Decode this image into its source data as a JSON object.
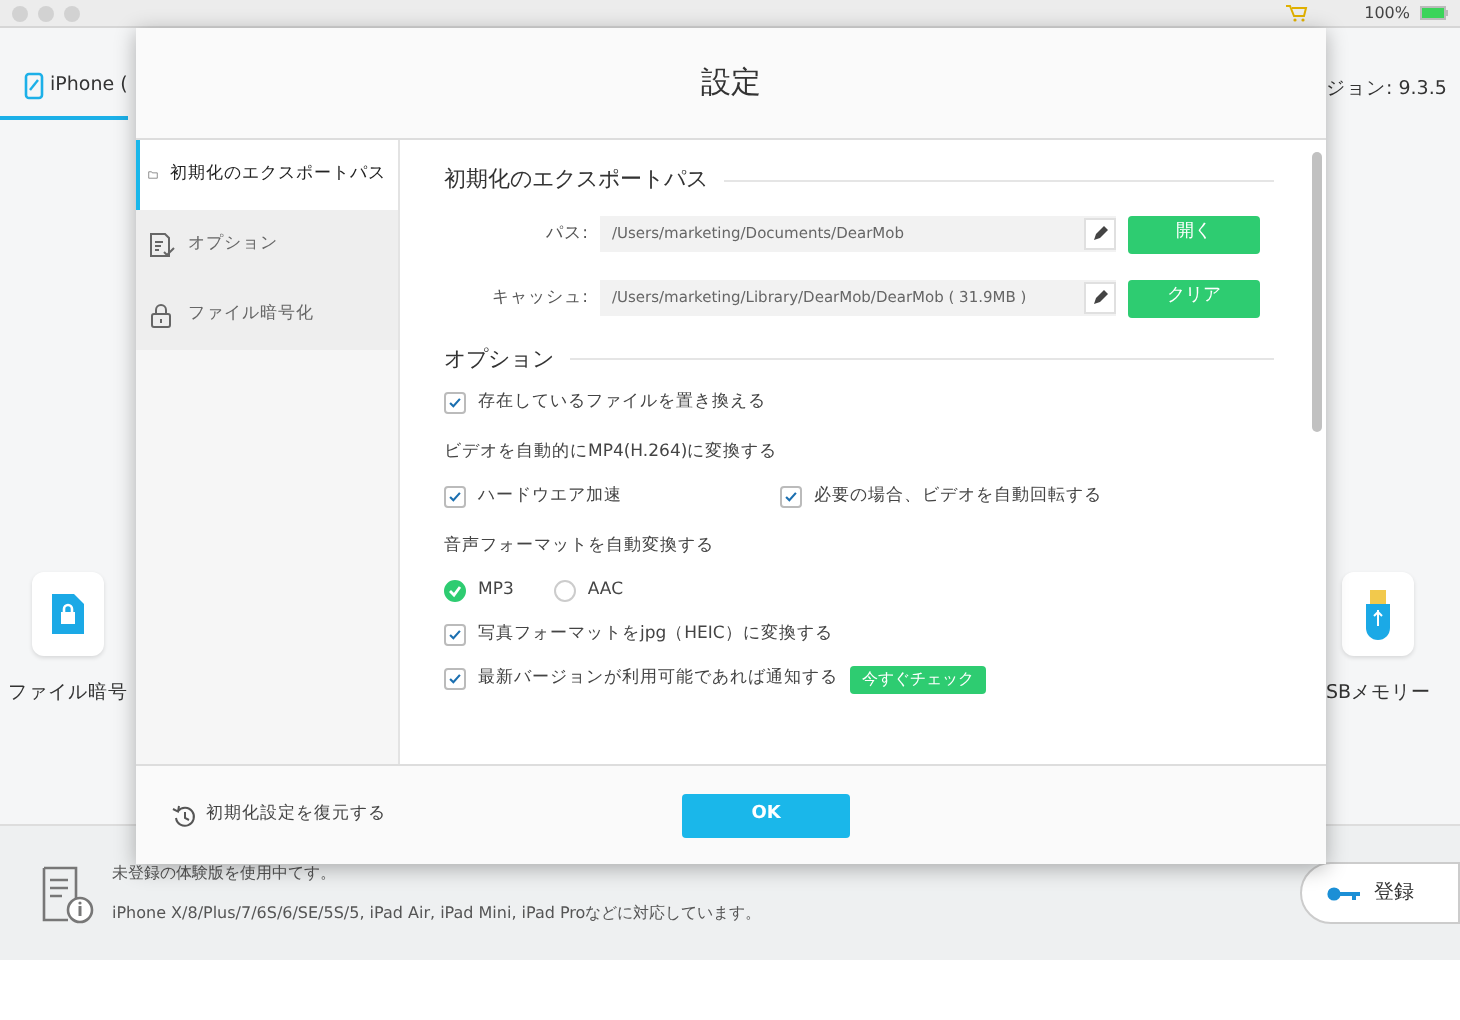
{
  "status_bar": {
    "battery": "100%"
  },
  "app": {
    "device_tab": {
      "label": "iPhone (",
      "selected": true
    },
    "version": "ジョン: 9.3.5",
    "tools": [
      {
        "label": "ファイル暗号",
        "kind": "lock"
      },
      {
        "label": "SBメモリー",
        "kind": "usb"
      }
    ]
  },
  "footer": {
    "lines": [
      "未登録の体験版を使用中てす。",
      "iPhone X/8/Plus/7/6S/6/SE/5S/5, iPad Air, iPad Mini, iPad Proなどに対応しています。"
    ],
    "register_button": "登録"
  },
  "dialog": {
    "title": "設定",
    "sidebar": [
      {
        "label": "初期化のエクスポートパス",
        "selected": true
      },
      {
        "label": "オプション",
        "selected": false
      },
      {
        "label": "ファイル暗号化",
        "selected": false
      }
    ],
    "export_heading": "初期化のエクスポートパス",
    "paths": [
      {
        "label": "パス:",
        "value": "/Users/marketing/Documents/DearMob",
        "button": "開く"
      },
      {
        "label": "キャッシュ:",
        "value": "/Users/marketing/Library/DearMob/DearMob ( 31.9MB )",
        "button": "クリア"
      }
    ],
    "options_heading": "オプション",
    "options": [
      {
        "kind": "checkbox",
        "label": "存在しているファイルを置き換える",
        "checked": true
      },
      {
        "kind": "label",
        "label": "ビデオを自動的にMP4(H.264)に変換する"
      },
      {
        "kind": "pair",
        "items": [
          {
            "label": "ハードウエア加速",
            "checked": true
          },
          {
            "label": "必要の場合、ビデオを自動回転する",
            "checked": true
          }
        ]
      },
      {
        "kind": "label",
        "label": "音声フォーマットを自動変換する"
      },
      {
        "kind": "radio",
        "items": [
          {
            "label": "MP3",
            "selected": true
          },
          {
            "label": "AAC",
            "selected": false
          }
        ]
      },
      {
        "kind": "checkbox",
        "label": "写真フォーマットをjpg（HEIC）に変換する",
        "checked": true
      },
      {
        "kind": "checkbox",
        "label": "最新バージョンが利用可能であれば通知する",
        "checked": true,
        "button": "今すぐチェック"
      }
    ],
    "reset_link": "初期化設定を復元する",
    "ok_button": "OK"
  }
}
